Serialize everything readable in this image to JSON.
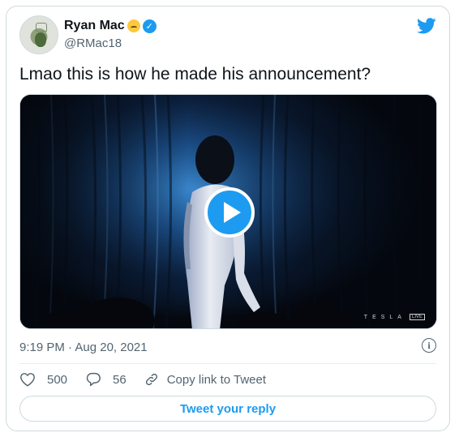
{
  "author": {
    "display_name": "Ryan Mac",
    "handle": "@RMac18",
    "verified_glyph": "✓"
  },
  "tweet": {
    "text": "Lmao this is how he made his announcement?",
    "timestamp": "9:19 PM · Aug 20, 2021"
  },
  "media": {
    "type": "video",
    "watermark": "TESLA",
    "live_label": "LIVE"
  },
  "actions": {
    "likes": "500",
    "replies": "56",
    "copy_link_label": "Copy link to Tweet"
  },
  "reply_button_label": "Tweet your reply",
  "info_glyph": "i",
  "colors": {
    "accent": "#1d9bf0",
    "text_secondary": "#536471",
    "border": "#cfd9de"
  },
  "icons": {
    "brand": "twitter-bird-icon",
    "verified": "verified-badge-icon",
    "emoji": "upside-down-face-icon",
    "play": "play-icon",
    "info": "info-icon",
    "like": "heart-icon",
    "reply": "reply-bubble-icon",
    "link": "link-icon"
  }
}
